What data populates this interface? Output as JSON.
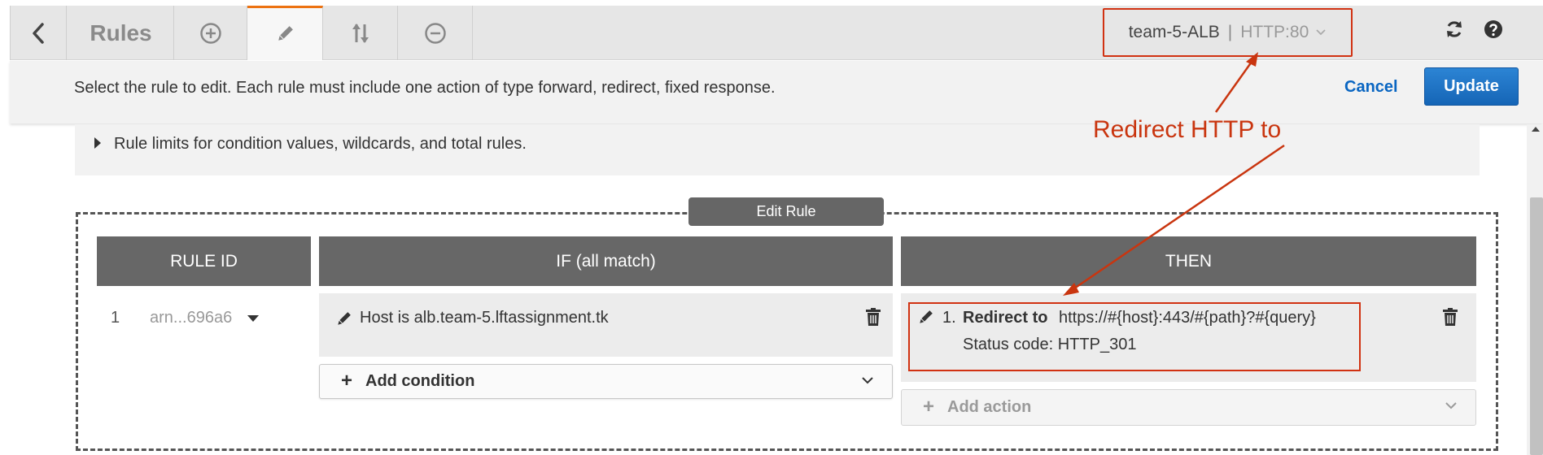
{
  "toolbar": {
    "tabs": [
      {
        "id": "back",
        "icon": "chevron-left-icon"
      },
      {
        "id": "rules",
        "label": "Rules"
      },
      {
        "id": "add",
        "icon": "plus-circle-icon"
      },
      {
        "id": "edit",
        "icon": "pencil-icon",
        "active": true
      },
      {
        "id": "reorder",
        "icon": "reorder-icon"
      },
      {
        "id": "delete",
        "icon": "minus-circle-icon"
      }
    ],
    "listener": {
      "name": "team-5-ALB",
      "separator": "|",
      "port": "HTTP:80"
    },
    "refresh_icon": "refresh-icon",
    "help_icon": "help-icon"
  },
  "instruction": {
    "text": "Select the rule to edit. Each rule must include one action of type forward, redirect, fixed response.",
    "cancel": "Cancel",
    "update": "Update"
  },
  "limits": {
    "text": "Rule limits for condition values, wildcards, and total rules."
  },
  "edit_rule": {
    "label": "Edit Rule",
    "headers": {
      "rule_id": "RULE ID",
      "if": "IF (all match)",
      "then": "THEN"
    },
    "rule": {
      "number": "1",
      "arn": "arn...696a6",
      "condition": "Host is alb.team-5.lftassignment.tk",
      "add_condition": "Add condition",
      "action": {
        "number": "1.",
        "type": "Redirect to",
        "target": "https://#{host}:443/#{path}?#{query}",
        "status": "Status code: HTTP_301"
      },
      "add_action": "Add action"
    }
  },
  "annotation": {
    "text": "Redirect HTTP to",
    "color": "#c9350f"
  },
  "colors": {
    "accent_orange": "#ec7211",
    "highlight_red": "#d13212",
    "primary_blue": "#1565b6",
    "header_gray": "#676767"
  }
}
